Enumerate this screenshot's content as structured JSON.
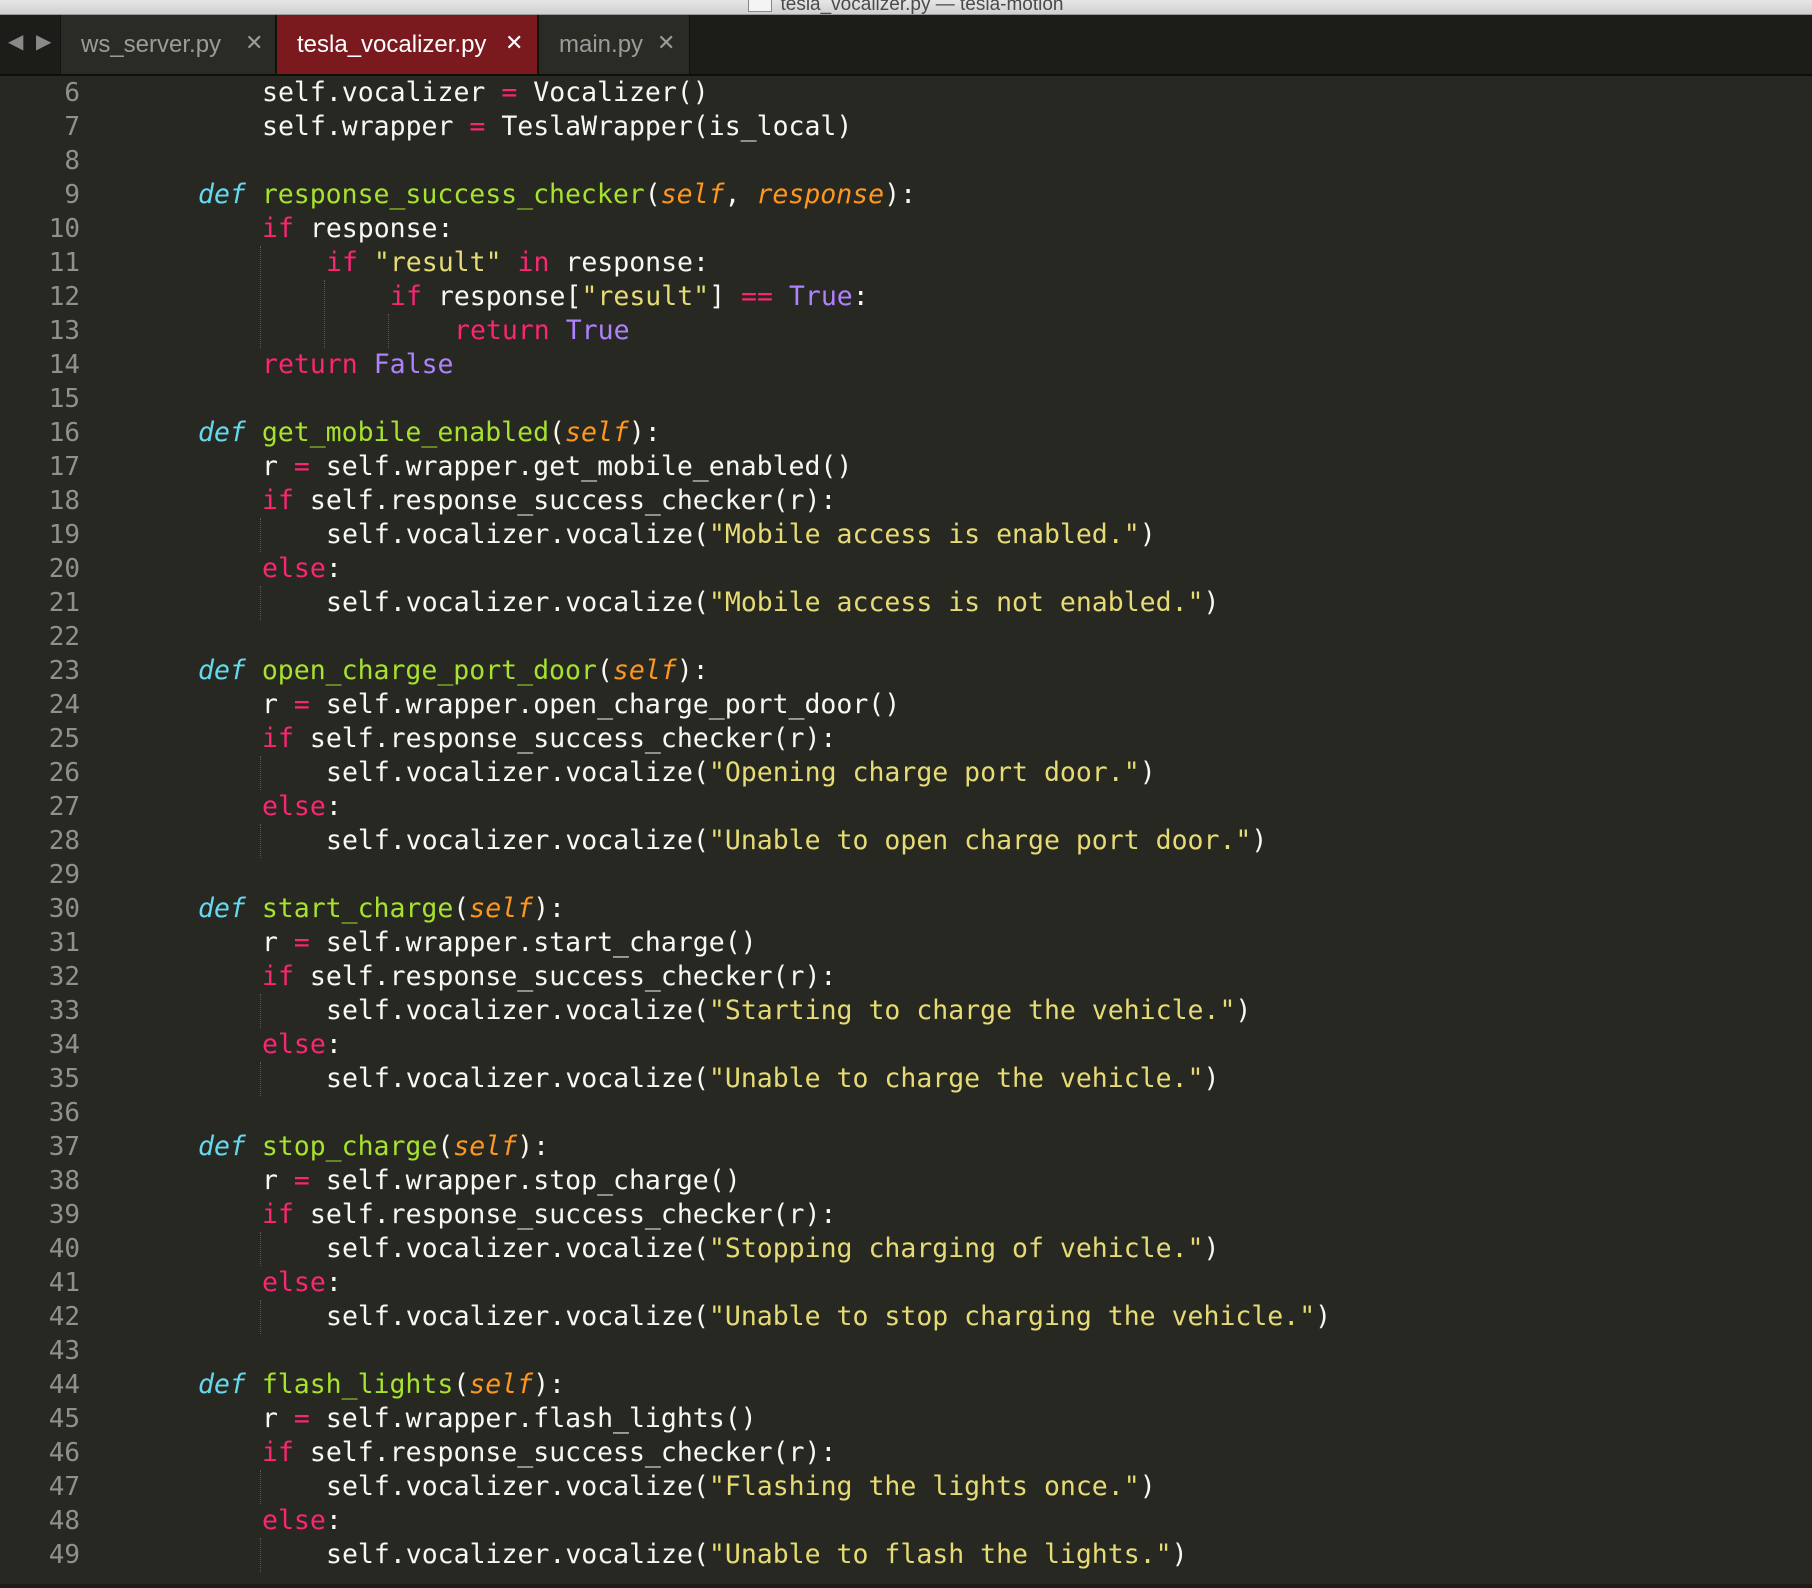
{
  "window": {
    "title": "tesla_vocalizer.py — tesla-motion"
  },
  "tabbar": {
    "back_icon": "◀",
    "forward_icon": "▶",
    "close_glyph": "✕",
    "tabs": [
      {
        "label": "ws_server.py",
        "active": false
      },
      {
        "label": "tesla_vocalizer.py",
        "active": true
      },
      {
        "label": "main.py",
        "active": false
      }
    ]
  },
  "colors": {
    "background": "#272822",
    "keyword": "#f92672",
    "storage": "#66d9ef",
    "function": "#a6e22e",
    "parameter": "#fd971f",
    "string": "#e6db74",
    "constant": "#ae81ff",
    "active_tab": "#7a1a1e"
  },
  "editor": {
    "lines": [
      {
        "n": "6",
        "indent": 2,
        "tokens": [
          [
            "self.vocalizer ",
            ""
          ],
          [
            "=",
            "op"
          ],
          [
            " Vocalizer()",
            ""
          ]
        ]
      },
      {
        "n": "7",
        "indent": 2,
        "tokens": [
          [
            "self.wrapper ",
            ""
          ],
          [
            "=",
            "op"
          ],
          [
            " TeslaWrapper(is_local)",
            ""
          ]
        ]
      },
      {
        "n": "8",
        "indent": 0,
        "tokens": []
      },
      {
        "n": "9",
        "indent": 1,
        "tokens": [
          [
            "def",
            "def"
          ],
          [
            " ",
            ""
          ],
          [
            "response_success_checker",
            "fn"
          ],
          [
            "(",
            ""
          ],
          [
            "self",
            "param"
          ],
          [
            ", ",
            ""
          ],
          [
            "response",
            "param"
          ],
          [
            "):",
            ""
          ]
        ]
      },
      {
        "n": "10",
        "indent": 2,
        "tokens": [
          [
            "if",
            "kw"
          ],
          [
            " response:",
            ""
          ]
        ]
      },
      {
        "n": "11",
        "indent": 3,
        "tokens": [
          [
            "if",
            "kw"
          ],
          [
            " ",
            ""
          ],
          [
            "\"result\"",
            "str"
          ],
          [
            " ",
            ""
          ],
          [
            "in",
            "kw"
          ],
          [
            " response:",
            ""
          ]
        ]
      },
      {
        "n": "12",
        "indent": 4,
        "tokens": [
          [
            "if",
            "kw"
          ],
          [
            " response[",
            ""
          ],
          [
            "\"result\"",
            "str"
          ],
          [
            "] ",
            ""
          ],
          [
            "==",
            "op"
          ],
          [
            " ",
            ""
          ],
          [
            "True",
            "const"
          ],
          [
            ":",
            ""
          ]
        ]
      },
      {
        "n": "13",
        "indent": 5,
        "tokens": [
          [
            "return",
            "kw"
          ],
          [
            " ",
            ""
          ],
          [
            "True",
            "const"
          ]
        ]
      },
      {
        "n": "14",
        "indent": 2,
        "tokens": [
          [
            "return",
            "kw"
          ],
          [
            " ",
            ""
          ],
          [
            "False",
            "const"
          ]
        ]
      },
      {
        "n": "15",
        "indent": 0,
        "tokens": []
      },
      {
        "n": "16",
        "indent": 1,
        "tokens": [
          [
            "def",
            "def"
          ],
          [
            " ",
            ""
          ],
          [
            "get_mobile_enabled",
            "fn"
          ],
          [
            "(",
            ""
          ],
          [
            "self",
            "param"
          ],
          [
            "):",
            ""
          ]
        ]
      },
      {
        "n": "17",
        "indent": 2,
        "tokens": [
          [
            "r ",
            ""
          ],
          [
            "=",
            "op"
          ],
          [
            " self.wrapper.get_mobile_enabled()",
            ""
          ]
        ]
      },
      {
        "n": "18",
        "indent": 2,
        "tokens": [
          [
            "if",
            "kw"
          ],
          [
            " self.response_success_checker(r):",
            ""
          ]
        ]
      },
      {
        "n": "19",
        "indent": 3,
        "tokens": [
          [
            "self.vocalizer.vocalize(",
            ""
          ],
          [
            "\"Mobile access is enabled.\"",
            "str"
          ],
          [
            ")",
            ""
          ]
        ]
      },
      {
        "n": "20",
        "indent": 2,
        "tokens": [
          [
            "else",
            "kw"
          ],
          [
            ":",
            ""
          ]
        ]
      },
      {
        "n": "21",
        "indent": 3,
        "tokens": [
          [
            "self.vocalizer.vocalize(",
            ""
          ],
          [
            "\"Mobile access is not enabled.\"",
            "str"
          ],
          [
            ")",
            ""
          ]
        ]
      },
      {
        "n": "22",
        "indent": 0,
        "tokens": []
      },
      {
        "n": "23",
        "indent": 1,
        "tokens": [
          [
            "def",
            "def"
          ],
          [
            " ",
            ""
          ],
          [
            "open_charge_port_door",
            "fn"
          ],
          [
            "(",
            ""
          ],
          [
            "self",
            "param"
          ],
          [
            "):",
            ""
          ]
        ]
      },
      {
        "n": "24",
        "indent": 2,
        "tokens": [
          [
            "r ",
            ""
          ],
          [
            "=",
            "op"
          ],
          [
            " self.wrapper.open_charge_port_door()",
            ""
          ]
        ]
      },
      {
        "n": "25",
        "indent": 2,
        "tokens": [
          [
            "if",
            "kw"
          ],
          [
            " self.response_success_checker(r):",
            ""
          ]
        ]
      },
      {
        "n": "26",
        "indent": 3,
        "tokens": [
          [
            "self.vocalizer.vocalize(",
            ""
          ],
          [
            "\"Opening charge port door.\"",
            "str"
          ],
          [
            ")",
            ""
          ]
        ]
      },
      {
        "n": "27",
        "indent": 2,
        "tokens": [
          [
            "else",
            "kw"
          ],
          [
            ":",
            ""
          ]
        ]
      },
      {
        "n": "28",
        "indent": 3,
        "tokens": [
          [
            "self.vocalizer.vocalize(",
            ""
          ],
          [
            "\"Unable to open charge port door.\"",
            "str"
          ],
          [
            ")",
            ""
          ]
        ]
      },
      {
        "n": "29",
        "indent": 0,
        "tokens": []
      },
      {
        "n": "30",
        "indent": 1,
        "tokens": [
          [
            "def",
            "def"
          ],
          [
            " ",
            ""
          ],
          [
            "start_charge",
            "fn"
          ],
          [
            "(",
            ""
          ],
          [
            "self",
            "param"
          ],
          [
            "):",
            ""
          ]
        ]
      },
      {
        "n": "31",
        "indent": 2,
        "tokens": [
          [
            "r ",
            ""
          ],
          [
            "=",
            "op"
          ],
          [
            " self.wrapper.start_charge()",
            ""
          ]
        ]
      },
      {
        "n": "32",
        "indent": 2,
        "tokens": [
          [
            "if",
            "kw"
          ],
          [
            " self.response_success_checker(r):",
            ""
          ]
        ]
      },
      {
        "n": "33",
        "indent": 3,
        "tokens": [
          [
            "self.vocalizer.vocalize(",
            ""
          ],
          [
            "\"Starting to charge the vehicle.\"",
            "str"
          ],
          [
            ")",
            ""
          ]
        ]
      },
      {
        "n": "34",
        "indent": 2,
        "tokens": [
          [
            "else",
            "kw"
          ],
          [
            ":",
            ""
          ]
        ]
      },
      {
        "n": "35",
        "indent": 3,
        "tokens": [
          [
            "self.vocalizer.vocalize(",
            ""
          ],
          [
            "\"Unable to charge the vehicle.\"",
            "str"
          ],
          [
            ")",
            ""
          ]
        ]
      },
      {
        "n": "36",
        "indent": 0,
        "tokens": []
      },
      {
        "n": "37",
        "indent": 1,
        "tokens": [
          [
            "def",
            "def"
          ],
          [
            " ",
            ""
          ],
          [
            "stop_charge",
            "fn"
          ],
          [
            "(",
            ""
          ],
          [
            "self",
            "param"
          ],
          [
            "):",
            ""
          ]
        ]
      },
      {
        "n": "38",
        "indent": 2,
        "tokens": [
          [
            "r ",
            ""
          ],
          [
            "=",
            "op"
          ],
          [
            " self.wrapper.stop_charge()",
            ""
          ]
        ]
      },
      {
        "n": "39",
        "indent": 2,
        "tokens": [
          [
            "if",
            "kw"
          ],
          [
            " self.response_success_checker(r):",
            ""
          ]
        ]
      },
      {
        "n": "40",
        "indent": 3,
        "tokens": [
          [
            "self.vocalizer.vocalize(",
            ""
          ],
          [
            "\"Stopping charging of vehicle.\"",
            "str"
          ],
          [
            ")",
            ""
          ]
        ]
      },
      {
        "n": "41",
        "indent": 2,
        "tokens": [
          [
            "else",
            "kw"
          ],
          [
            ":",
            ""
          ]
        ]
      },
      {
        "n": "42",
        "indent": 3,
        "tokens": [
          [
            "self.vocalizer.vocalize(",
            ""
          ],
          [
            "\"Unable to stop charging the vehicle.\"",
            "str"
          ],
          [
            ")",
            ""
          ]
        ]
      },
      {
        "n": "43",
        "indent": 0,
        "tokens": []
      },
      {
        "n": "44",
        "indent": 1,
        "tokens": [
          [
            "def",
            "def"
          ],
          [
            " ",
            ""
          ],
          [
            "flash_lights",
            "fn"
          ],
          [
            "(",
            ""
          ],
          [
            "self",
            "param"
          ],
          [
            "):",
            ""
          ]
        ]
      },
      {
        "n": "45",
        "indent": 2,
        "tokens": [
          [
            "r ",
            ""
          ],
          [
            "=",
            "op"
          ],
          [
            " self.wrapper.flash_lights()",
            ""
          ]
        ]
      },
      {
        "n": "46",
        "indent": 2,
        "tokens": [
          [
            "if",
            "kw"
          ],
          [
            " self.response_success_checker(r):",
            ""
          ]
        ]
      },
      {
        "n": "47",
        "indent": 3,
        "tokens": [
          [
            "self.vocalizer.vocalize(",
            ""
          ],
          [
            "\"Flashing the lights once.\"",
            "str"
          ],
          [
            ")",
            ""
          ]
        ]
      },
      {
        "n": "48",
        "indent": 2,
        "tokens": [
          [
            "else",
            "kw"
          ],
          [
            ":",
            ""
          ]
        ]
      },
      {
        "n": "49",
        "indent": 3,
        "tokens": [
          [
            "self.vocalizer.vocalize(",
            ""
          ],
          [
            "\"Unable to flash the lights.\"",
            "str"
          ],
          [
            ")",
            ""
          ]
        ]
      }
    ]
  }
}
